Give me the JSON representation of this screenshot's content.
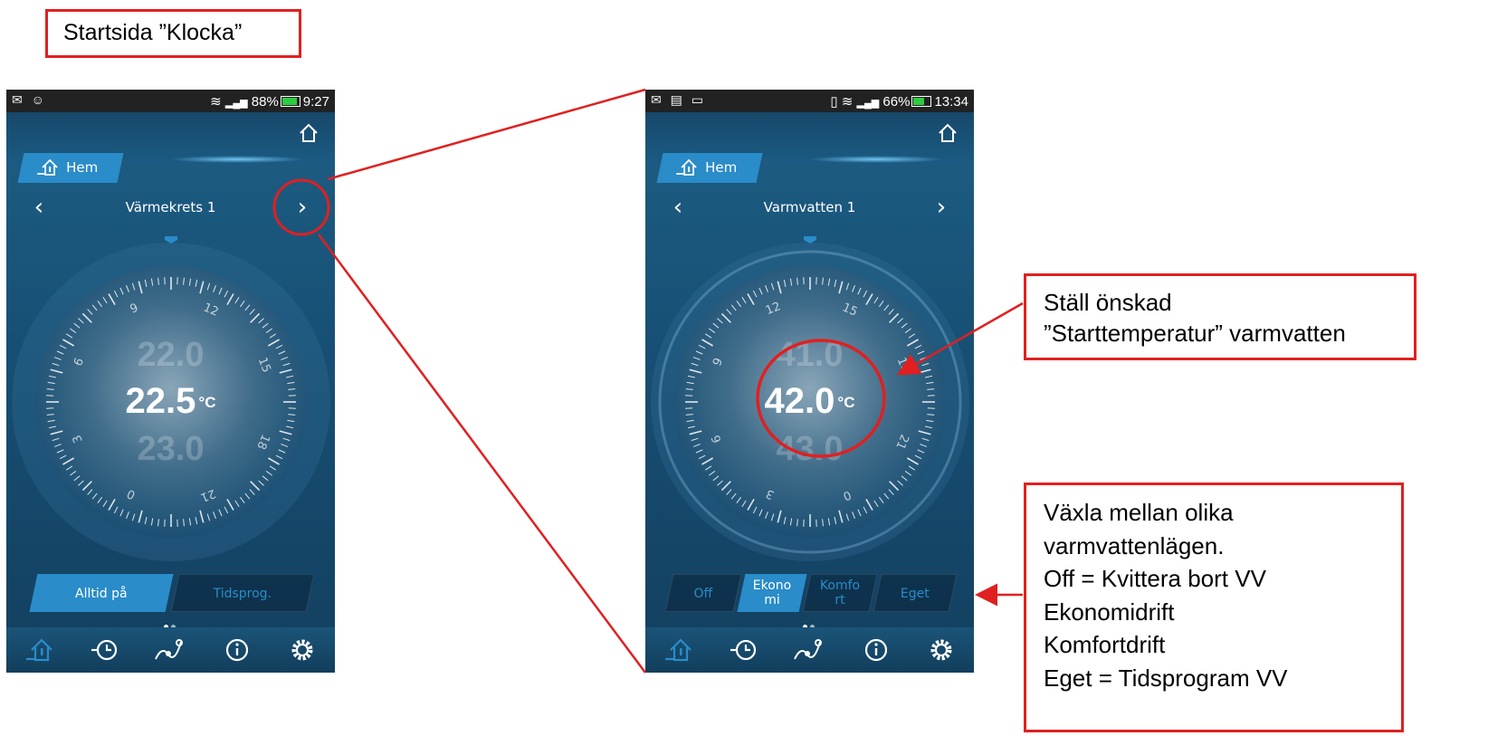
{
  "callouts": {
    "title": "Startsida ”Klocka”",
    "start_temp": [
      "Ställ önskad",
      "”Starttemperatur” varmvatten"
    ],
    "modes": [
      "Växla mellan olika",
      "varmvattenlägen.",
      "Off = Kvittera bort VV",
      "Ekonomidrift",
      "Komfortdrift",
      "Eget = Tidsprogram VV"
    ]
  },
  "left_phone": {
    "status": {
      "left_icons": "✉ ☺",
      "signal": "▂▄▆",
      "battery_pct": "88%",
      "time": "9:27",
      "battery_level": 0.88
    },
    "hem_label": "Hem",
    "circuit": "Värmekrets 1",
    "temp_above": "22.0",
    "temp_current": "22.5",
    "temp_below": "23.0",
    "unit": "°C",
    "dial_hours": [
      "9",
      "12",
      "15",
      "18",
      "21",
      "0",
      "3",
      "6"
    ],
    "modes": [
      "Alltid på",
      "Tidsprog."
    ],
    "active_mode": "Alltid på"
  },
  "right_phone": {
    "status": {
      "left_icons": "✉ ▤ ▭",
      "vibrate": "▯",
      "signal": "▂▄▆",
      "battery_pct": "66%",
      "time": "13:34",
      "battery_level": 0.66
    },
    "hem_label": "Hem",
    "circuit": "Varmvatten 1",
    "temp_above": "41.0",
    "temp_current": "42.0",
    "temp_below": "43.0",
    "unit": "°C",
    "dial_hours": [
      "12",
      "15",
      "18",
      "21",
      "0",
      "3",
      "6",
      "9"
    ],
    "modes": [
      "Off",
      "Ekono\nmi",
      "Komfo\nrt",
      "Eget"
    ],
    "active_mode": "Ekono\nmi"
  },
  "icons": [
    "home-outline-icon",
    "house-thermometer-icon",
    "clock-history-icon",
    "curve-graph-icon",
    "info-icon",
    "gear-icon",
    "chevron-left-icon",
    "chevron-right-icon"
  ],
  "colors": {
    "callout_border": "#e02020",
    "accent": "#2a8cc8",
    "bg_dark": "#133f5f"
  }
}
